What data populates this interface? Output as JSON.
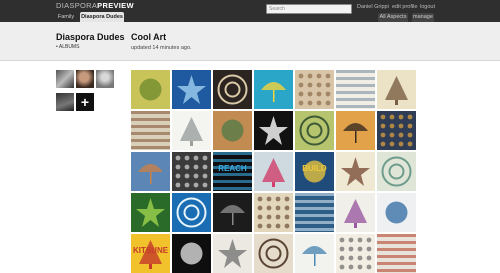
{
  "topbar": {
    "logo": "DIASPORA",
    "logo_suffix": "PREVIEW",
    "tabs": [
      {
        "label": "Family"
      },
      {
        "label": "Diaspora Dudes"
      }
    ],
    "search_placeholder": "Search",
    "user_name": "Daniel Grippi",
    "edit_profile": "edit profile",
    "logout": "logout",
    "all_aspects": "All Aspects",
    "manage": "manage"
  },
  "header": {
    "aspect_title": "Diaspora Dudes",
    "albums_link": "• ALBUMS",
    "album_title": "Cool Art",
    "updated": "updated 14 minutes ago."
  },
  "people": {
    "add_glyph": "+"
  },
  "photos": [
    {
      "text": "",
      "bg": "#c9c45a",
      "fg": "#6e8a2c"
    },
    {
      "text": "",
      "bg": "#1f5aa0",
      "fg": "#9fd0f0"
    },
    {
      "text": "",
      "bg": "#2b2420",
      "fg": "#d9c9a8"
    },
    {
      "text": "",
      "bg": "#2aa6c9",
      "fg": "#f5d33b"
    },
    {
      "text": "",
      "bg": "#d9c6a8",
      "fg": "#8a6c4b"
    },
    {
      "text": "",
      "bg": "#f1efe5",
      "fg": "#7b8fa0"
    },
    {
      "text": "",
      "bg": "#ece3c7",
      "fg": "#7a5e43"
    },
    {
      "text": "",
      "bg": "#d8d0b8",
      "fg": "#8a5a3a"
    },
    {
      "text": "",
      "bg": "#f4f4f0",
      "fg": "#9aa0a0"
    },
    {
      "text": "",
      "bg": "#c28b52",
      "fg": "#4f7a48"
    },
    {
      "text": "",
      "bg": "#111111",
      "fg": "#ffffff"
    },
    {
      "text": "",
      "bg": "#b7c46e",
      "fg": "#3d5a37"
    },
    {
      "text": "",
      "bg": "#e2a24a",
      "fg": "#3a2d21"
    },
    {
      "text": "",
      "bg": "#2e3c56",
      "fg": "#e4a63c"
    },
    {
      "text": "",
      "bg": "#5b86b5",
      "fg": "#c8814b"
    },
    {
      "text": "",
      "bg": "#3b3b3b",
      "fg": "#d9d9d9"
    },
    {
      "text": "REACH",
      "bg": "#0f0f12",
      "fg": "#3aa9e0"
    },
    {
      "text": "",
      "bg": "#cfd9e0",
      "fg": "#d03f6c"
    },
    {
      "text": "BUILD",
      "bg": "#1f4c7a",
      "fg": "#f0c83b"
    },
    {
      "text": "",
      "bg": "#efe8d2",
      "fg": "#7a4d3a"
    },
    {
      "text": "",
      "bg": "#dfe6d8",
      "fg": "#6e9c8c"
    },
    {
      "text": "",
      "bg": "#2b6b2a",
      "fg": "#9fd34d"
    },
    {
      "text": "",
      "bg": "#1a6db3",
      "fg": "#e8f4fb"
    },
    {
      "text": "",
      "bg": "#1c1c1c",
      "fg": "#8a8a8a"
    },
    {
      "text": "",
      "bg": "#e2d7bd",
      "fg": "#6d5037"
    },
    {
      "text": "",
      "bg": "#2c5e88",
      "fg": "#d5e5f2"
    },
    {
      "text": "",
      "bg": "#f1efe9",
      "fg": "#9b5aa1"
    },
    {
      "text": "",
      "bg": "#eef0f2",
      "fg": "#2f6ba3"
    },
    {
      "text": "KITSUNE",
      "bg": "#f1c22b",
      "fg": "#c53a2a"
    },
    {
      "text": "",
      "bg": "#0e0e0e",
      "fg": "#e9e9e9"
    },
    {
      "text": "",
      "bg": "#ece9e2",
      "fg": "#767676"
    },
    {
      "text": "",
      "bg": "#e6dccb",
      "fg": "#5a4533"
    },
    {
      "text": "",
      "bg": "#f2f2ef",
      "fg": "#4d88b3"
    },
    {
      "text": "",
      "bg": "#f2eee3",
      "fg": "#6a6a6a"
    },
    {
      "text": "",
      "bg": "#e8e3da",
      "fg": "#b5452e"
    }
  ]
}
